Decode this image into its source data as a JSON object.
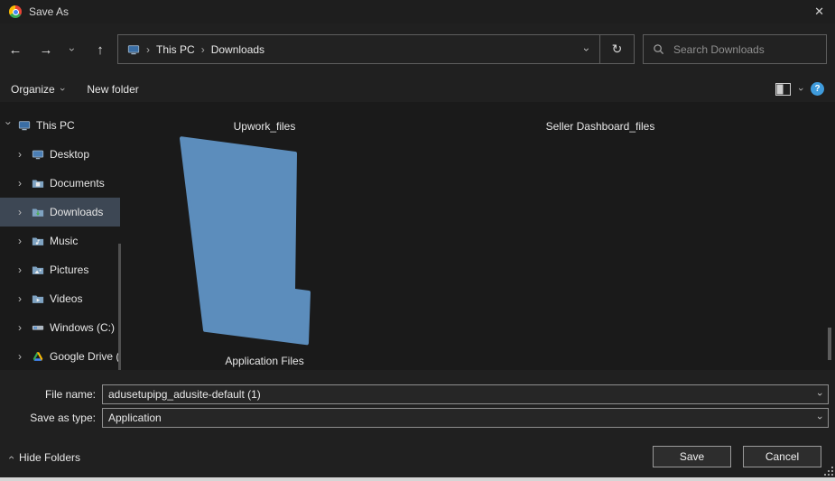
{
  "titlebar": {
    "title": "Save As"
  },
  "icons": {
    "back": "←",
    "forward": "→",
    "up": "↑",
    "chevron": "›",
    "refresh": "↻",
    "close": "✕",
    "separator": "›",
    "question": "?"
  },
  "breadcrumb": {
    "items": [
      "This PC",
      "Downloads"
    ]
  },
  "nav": {
    "search_placeholder": "Search Downloads"
  },
  "toolbar": {
    "organize_label": "Organize",
    "new_folder_label": "New folder"
  },
  "sidebar": {
    "items": [
      {
        "label": "This PC"
      },
      {
        "label": "Desktop"
      },
      {
        "label": "Documents"
      },
      {
        "label": "Downloads",
        "selected": true
      },
      {
        "label": "Music"
      },
      {
        "label": "Pictures"
      },
      {
        "label": "Videos"
      },
      {
        "label": "Windows (C:)"
      },
      {
        "label": "Google Drive (G"
      }
    ]
  },
  "files": {
    "items": [
      {
        "label": "Upwork_files"
      },
      {
        "label": "Seller Dashboard_files"
      },
      {
        "label": "Application Files"
      }
    ],
    "folder_color": "#5c8dbc"
  },
  "form": {
    "file_name_label": "File name:",
    "file_name_value": "adusetupipg_adusite-default (1)",
    "save_type_label": "Save as type:",
    "save_type_value": "Application"
  },
  "footer": {
    "hide_folders_label": "Hide Folders",
    "save_label": "Save",
    "cancel_label": "Cancel"
  }
}
